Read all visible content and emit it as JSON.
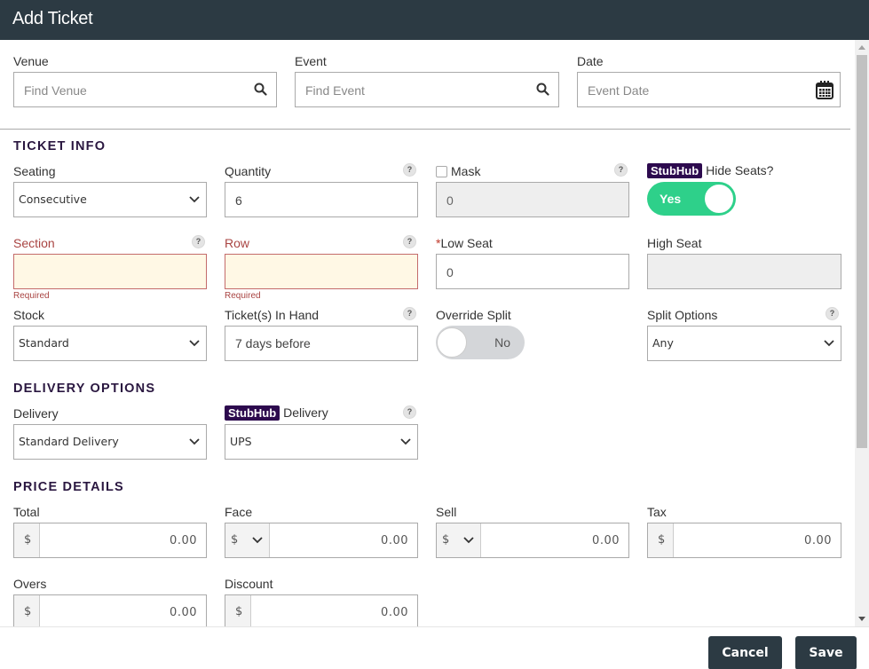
{
  "header": {
    "title": "Add Ticket"
  },
  "search": {
    "venue": {
      "label": "Venue",
      "placeholder": "Find Venue",
      "icon": "search-icon"
    },
    "event": {
      "label": "Event",
      "placeholder": "Find Event",
      "icon": "search-icon"
    },
    "date": {
      "label": "Date",
      "placeholder": "Event Date",
      "icon": "calendar-icon"
    }
  },
  "ticket_info": {
    "title": "TICKET INFO",
    "seating": {
      "label": "Seating",
      "value": "Consecutive"
    },
    "quantity": {
      "label": "Quantity",
      "value": "6",
      "help": "?"
    },
    "mask": {
      "label": "Mask",
      "value": "0",
      "checked": false,
      "help": "?"
    },
    "hide_seats": {
      "badge": "StubHub",
      "label": "Hide Seats?",
      "toggle": "Yes",
      "on": true
    },
    "section": {
      "label": "Section",
      "value": "",
      "error": "Required",
      "help": "?"
    },
    "row": {
      "label": "Row",
      "value": "",
      "error": "Required",
      "help": "?"
    },
    "low_seat": {
      "required_mark": "*",
      "label": "Low Seat",
      "value": "0"
    },
    "high_seat": {
      "label": "High Seat",
      "value": ""
    },
    "stock": {
      "label": "Stock",
      "value": "Standard"
    },
    "in_hand": {
      "label": "Ticket(s) In Hand",
      "value": "7 days before",
      "help": "?"
    },
    "override_split": {
      "label": "Override Split",
      "toggle": "No",
      "on": false
    },
    "split_options": {
      "label": "Split Options",
      "value": "Any",
      "help": "?"
    }
  },
  "delivery": {
    "title": "DELIVERY OPTIONS",
    "delivery": {
      "label": "Delivery",
      "value": "Standard Delivery"
    },
    "stubhub_delivery": {
      "badge": "StubHub",
      "label": "Delivery",
      "value": "UPS",
      "help": "?"
    }
  },
  "price": {
    "title": "PRICE DETAILS",
    "total": {
      "label": "Total",
      "currency": "$",
      "value": "0.00"
    },
    "face": {
      "label": "Face",
      "currency": "$",
      "value": "0.00"
    },
    "sell": {
      "label": "Sell",
      "currency": "$",
      "value": "0.00"
    },
    "tax": {
      "label": "Tax",
      "currency": "$",
      "value": "0.00"
    },
    "overs": {
      "label": "Overs",
      "currency": "$",
      "value": "0.00"
    },
    "discount": {
      "label": "Discount",
      "currency": "$",
      "value": "0.00"
    }
  },
  "footer": {
    "cancel_label": "Cancel",
    "save_label": "Save"
  },
  "colors": {
    "header_bg": "#2c3a43",
    "section_title": "#2a1740",
    "stubhub_badge": "#2d0a4e",
    "toggle_on": "#2ed08a",
    "error": "#a94442",
    "error_bg": "#fff8e5"
  }
}
